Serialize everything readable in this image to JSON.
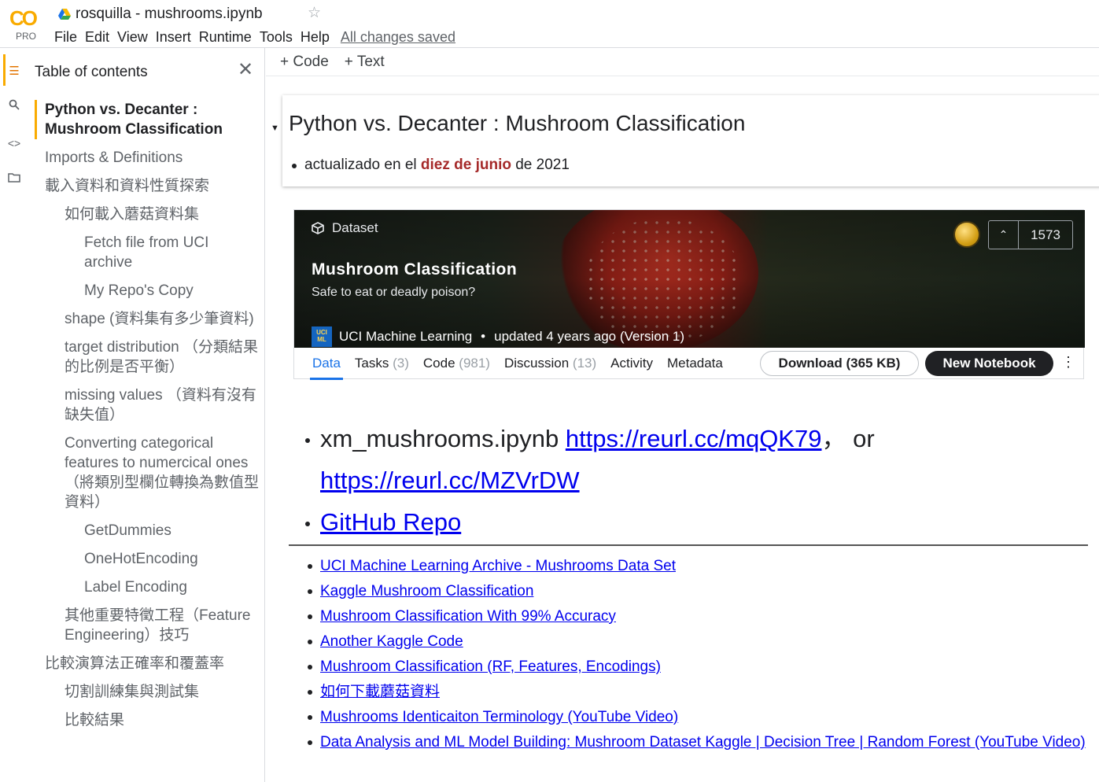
{
  "app": {
    "logo_text": "CO",
    "logo_badge": "PRO",
    "title": "rosquilla - mushrooms.ipynb",
    "save_status": "All changes saved"
  },
  "menu": [
    "File",
    "Edit",
    "View",
    "Insert",
    "Runtime",
    "Tools",
    "Help"
  ],
  "toolbar": {
    "add_code": "+ Code",
    "add_text": "+ Text"
  },
  "sidebar": {
    "header": "Table of contents",
    "items": [
      {
        "label": "Python vs. Decanter : Mushroom Classification",
        "level": 1,
        "active": true
      },
      {
        "label": "Imports & Definitions",
        "level": 1,
        "active": false
      },
      {
        "label": "載入資料和資料性質探索",
        "level": 1,
        "active": false
      },
      {
        "label": "如何載入蘑菇資料集",
        "level": 2,
        "active": false
      },
      {
        "label": "Fetch file from UCI archive",
        "level": 3,
        "active": false
      },
      {
        "label": "My Repo's Copy",
        "level": 3,
        "active": false
      },
      {
        "label": "shape (資料集有多少筆資料)",
        "level": 2,
        "active": false
      },
      {
        "label": "target distribution （分類結果的比例是否平衡）",
        "level": 2,
        "active": false
      },
      {
        "label": "missing values （資料有沒有缺失值）",
        "level": 2,
        "active": false
      },
      {
        "label": "Converting categorical features to numercical ones （將類別型欄位轉換為數值型資料）",
        "level": 2,
        "active": false
      },
      {
        "label": "GetDummies",
        "level": 3,
        "active": false
      },
      {
        "label": "OneHotEncoding",
        "level": 3,
        "active": false
      },
      {
        "label": "Label Encoding",
        "level": 3,
        "active": false
      },
      {
        "label": "其他重要特徵工程（Feature Engineering）技巧",
        "level": 2,
        "active": false
      },
      {
        "label": "比較演算法正確率和覆蓋率",
        "level": 1,
        "active": false
      },
      {
        "label": "切割訓練集與測試集",
        "level": 2,
        "active": false
      },
      {
        "label": "比較結果",
        "level": 2,
        "active": false
      }
    ]
  },
  "cell": {
    "title": "Python vs. Decanter : Mushroom Classification",
    "bullet_prefix": "actualizado en el ",
    "bullet_highlight": "diez de junio",
    "bullet_suffix": " de 2021"
  },
  "dataset": {
    "label": "Dataset",
    "title": "Mushroom Classification",
    "subtitle": "Safe to eat or deadly poison?",
    "org_badge": "UCI ML",
    "org": "UCI Machine Learning",
    "meta_sep": "•",
    "updated": "updated 4 years ago (Version 1)",
    "vote_up": "⌃",
    "votes": "1573",
    "tabs": [
      {
        "label": "Data",
        "count": ""
      },
      {
        "label": "Tasks",
        "count": "(3)"
      },
      {
        "label": "Code",
        "count": "(981)"
      },
      {
        "label": "Discussion",
        "count": "(13)"
      },
      {
        "label": "Activity",
        "count": ""
      },
      {
        "label": "Metadata",
        "count": ""
      }
    ],
    "download": "Download (365 KB)",
    "new_notebook": "New Notebook",
    "more": "⋮"
  },
  "big_links": {
    "item1_text": "xm_mushrooms.ipynb ",
    "item1_link1": "https://reurl.cc/mqQK79",
    "item1_sep": "， or ",
    "item1_link2": "https://reurl.cc/MZVrDW",
    "item2_link": "GitHub Repo"
  },
  "links": [
    "UCI Machine Learning Archive - Mushrooms Data Set",
    "Kaggle Mushroom Classification",
    "Mushroom Classification With 99% Accuracy",
    "Another Kaggle Code",
    "Mushroom Classification (RF, Features, Encodings)",
    "如何下載蘑菇資料",
    "Mushrooms Identicaiton Terminology (YouTube Video)",
    "Data Analysis and ML Model Building: Mushroom Dataset Kaggle | Decision Tree | Random Forest (YouTube Video)"
  ],
  "colors": {
    "accent": "#f9ab00",
    "link": "#0000ee",
    "highlight": "#a52a2a",
    "tab_active": "#1a73e8"
  }
}
